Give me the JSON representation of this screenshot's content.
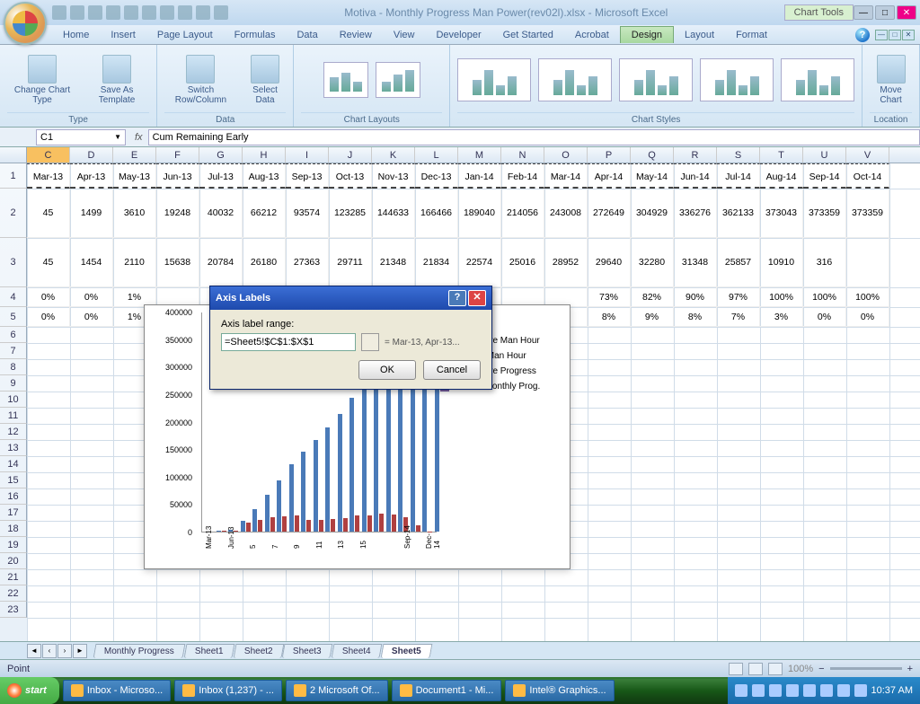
{
  "title": "Motiva - Monthly Progress  Man Power(rev02l).xlsx - Microsoft Excel",
  "chart_tools_label": "Chart Tools",
  "menu": [
    "Home",
    "Insert",
    "Page Layout",
    "Formulas",
    "Data",
    "Review",
    "View",
    "Developer",
    "Get Started",
    "Acrobat",
    "Design",
    "Layout",
    "Format"
  ],
  "ribbon": {
    "type_group": "Type",
    "change_chart": "Change Chart Type",
    "save_template": "Save As Template",
    "data_group": "Data",
    "switch": "Switch Row/Column",
    "select": "Select Data",
    "layouts": "Chart Layouts",
    "styles": "Chart Styles",
    "location": "Location",
    "move": "Move Chart"
  },
  "namebox": "C1",
  "formula": "Cum Remaining Early",
  "columns": [
    "C",
    "D",
    "E",
    "F",
    "G",
    "H",
    "I",
    "J",
    "K",
    "L",
    "M",
    "N",
    "O",
    "P",
    "Q",
    "R",
    "S",
    "T",
    "U",
    "V"
  ],
  "row1": [
    "Mar-13",
    "Apr-13",
    "May-13",
    "Jun-13",
    "Jul-13",
    "Aug-13",
    "Sep-13",
    "Oct-13",
    "Nov-13",
    "Dec-13",
    "Jan-14",
    "Feb-14",
    "Mar-14",
    "Apr-14",
    "May-14",
    "Jun-14",
    "Jul-14",
    "Aug-14",
    "Sep-14",
    "Oct-14"
  ],
  "row2": [
    "45",
    "1499",
    "3610",
    "19248",
    "40032",
    "66212",
    "93574",
    "123285",
    "144633",
    "166466",
    "189040",
    "214056",
    "243008",
    "272649",
    "304929",
    "336276",
    "362133",
    "373043",
    "373359",
    "373359"
  ],
  "row3": [
    "45",
    "1454",
    "2110",
    "15638",
    "20784",
    "26180",
    "27363",
    "29711",
    "21348",
    "21834",
    "22574",
    "25016",
    "28952",
    "29640",
    "32280",
    "31348",
    "25857",
    "10910",
    "316",
    ""
  ],
  "row4": [
    "0%",
    "0%",
    "1%",
    "",
    "",
    "",
    "",
    "",
    "",
    "",
    "",
    "",
    "",
    "73%",
    "82%",
    "90%",
    "97%",
    "100%",
    "100%",
    "100%"
  ],
  "row5": [
    "0%",
    "0%",
    "1%",
    "",
    "",
    "",
    "",
    "",
    "",
    "",
    "",
    "",
    "",
    "8%",
    "9%",
    "8%",
    "7%",
    "3%",
    "0%",
    "0%"
  ],
  "dialog": {
    "title": "Axis Labels",
    "label": "Axis label range:",
    "value": "=Sheet5!$C$1:$X$1",
    "preview": "= Mar-13, Apr-13...",
    "ok": "OK",
    "cancel": "Cancel"
  },
  "chart_data": {
    "type": "bar",
    "title": "",
    "y_ticks": [
      0,
      50000,
      100000,
      150000,
      200000,
      250000,
      300000,
      350000,
      400000
    ],
    "ylim": [
      0,
      400000
    ],
    "x_labels_visible": [
      "Mar-13",
      "Jun-13",
      "5",
      "7",
      "9",
      "11",
      "13",
      "15",
      "",
      "Sep-14",
      "Dec-14"
    ],
    "series": [
      {
        "name": "Cumulative Man Hour",
        "color": "#4a7ab8",
        "values": [
          45,
          1499,
          3610,
          19248,
          40032,
          66212,
          93574,
          123285,
          144633,
          166466,
          189040,
          214056,
          243008,
          272649,
          304929,
          336276,
          362133,
          373043,
          373359,
          373359
        ]
      },
      {
        "name": "Monthly Man Hour",
        "color": "#b04040",
        "values": [
          45,
          1454,
          2110,
          15638,
          20784,
          26180,
          27363,
          29711,
          21348,
          21834,
          22574,
          25016,
          28952,
          29640,
          32280,
          31348,
          25857,
          10910,
          316,
          0
        ]
      },
      {
        "name": "Cumulative Progress",
        "color": "#8ab060",
        "values": []
      },
      {
        "name": "Interval Monthly Prog.",
        "color": "#7a60a8",
        "values": []
      }
    ]
  },
  "sheet_tabs": [
    "Monthly Progress",
    "Sheet1",
    "Sheet2",
    "Sheet3",
    "Sheet4",
    "Sheet5"
  ],
  "status": "Point",
  "zoom": "100%",
  "taskbar": {
    "start": "start",
    "items": [
      "Inbox - Microso...",
      "Inbox (1,237) - ...",
      "2 Microsoft Of...",
      "Document1 - Mi...",
      "Intel® Graphics..."
    ],
    "time": "10:37 AM"
  }
}
